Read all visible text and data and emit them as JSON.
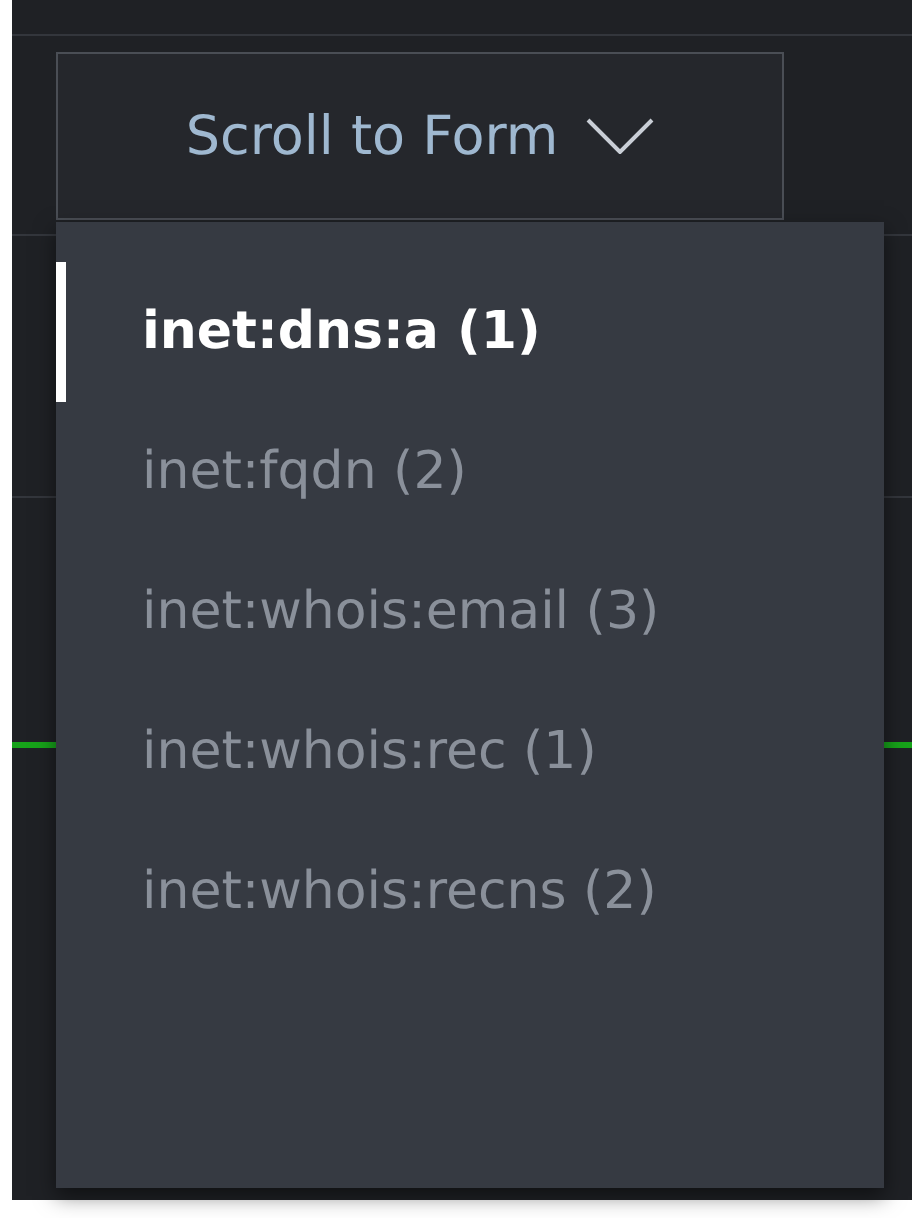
{
  "scroll_button": {
    "label": "Scroll to Form",
    "expanded": true
  },
  "menu": {
    "items": [
      {
        "label": "inet:dns:a (1)",
        "selected": true
      },
      {
        "label": "inet:fqdn (2)",
        "selected": false
      },
      {
        "label": "inet:whois:email (3)",
        "selected": false
      },
      {
        "label": "inet:whois:rec (1)",
        "selected": false
      },
      {
        "label": "inet:whois:recns (2)",
        "selected": false
      }
    ]
  }
}
